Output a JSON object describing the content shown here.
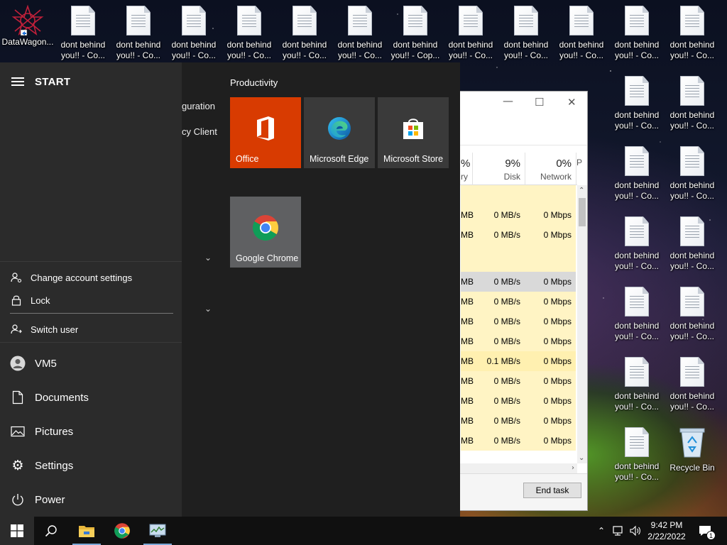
{
  "desktop": {
    "top_left_shortcut": {
      "label": "DataWagon..."
    },
    "file_label_top": "dont behind\nyou!! - Co...",
    "file_label_alt": "dont behind\nyou!! - Cop...",
    "file_label_partial": "hind\n Co...",
    "recycle_bin": {
      "label": "Recycle Bin"
    }
  },
  "task_manager": {
    "columns": [
      {
        "pct": "%",
        "label": "ry"
      },
      {
        "pct": "9%",
        "label": "Disk"
      },
      {
        "pct": "0%",
        "label": "Network"
      },
      {
        "pct": "",
        "label": "P"
      }
    ],
    "rows": [
      {
        "mem": "",
        "disk": "",
        "net": ""
      },
      {
        "mem": "MB",
        "disk": "0 MB/s",
        "net": "0 Mbps"
      },
      {
        "mem": "MB",
        "disk": "0 MB/s",
        "net": "0 Mbps"
      },
      {
        "mem": "",
        "disk": "",
        "net": ""
      },
      {
        "mem": "MB",
        "disk": "0 MB/s",
        "net": "0 Mbps"
      },
      {
        "mem": "MB",
        "disk": "0 MB/s",
        "net": "0 Mbps"
      },
      {
        "mem": "MB",
        "disk": "0 MB/s",
        "net": "0 Mbps"
      },
      {
        "mem": "MB",
        "disk": "0 MB/s",
        "net": "0 Mbps"
      },
      {
        "mem": "MB",
        "disk": "0.1 MB/s",
        "net": "0 Mbps"
      },
      {
        "mem": "MB",
        "disk": "0 MB/s",
        "net": "0 Mbps"
      },
      {
        "mem": "MB",
        "disk": "0 MB/s",
        "net": "0 Mbps"
      },
      {
        "mem": "MB",
        "disk": "0 MB/s",
        "net": "0 Mbps"
      },
      {
        "mem": "MB",
        "disk": "0 MB/s",
        "net": "0 Mbps"
      }
    ],
    "end_task_label": "End task"
  },
  "start_menu": {
    "title": "START",
    "account_menu": {
      "change_account_settings": "Change account settings",
      "lock": "Lock",
      "switch_user": "Switch user"
    },
    "rail": {
      "user": "VM5",
      "documents": "Documents",
      "pictures": "Pictures",
      "settings": "Settings",
      "power": "Power"
    },
    "list_fragments": {
      "first": "guration",
      "second": "cy Client"
    },
    "group_title": "Productivity",
    "tiles": {
      "office": "Office",
      "edge": "Microsoft Edge",
      "store": "Microsoft Store",
      "chrome": "Google Chrome"
    }
  },
  "taskbar": {
    "time": "9:42 PM",
    "date": "2/22/2022",
    "notification_count": "1"
  },
  "colors": {
    "office_tile": "#d83b01",
    "tile_dark": "#3a3a3a",
    "chrome_tile": "#5f6062",
    "row_highlight": "#fff4c4",
    "selected_row": "#d9d9d9"
  }
}
